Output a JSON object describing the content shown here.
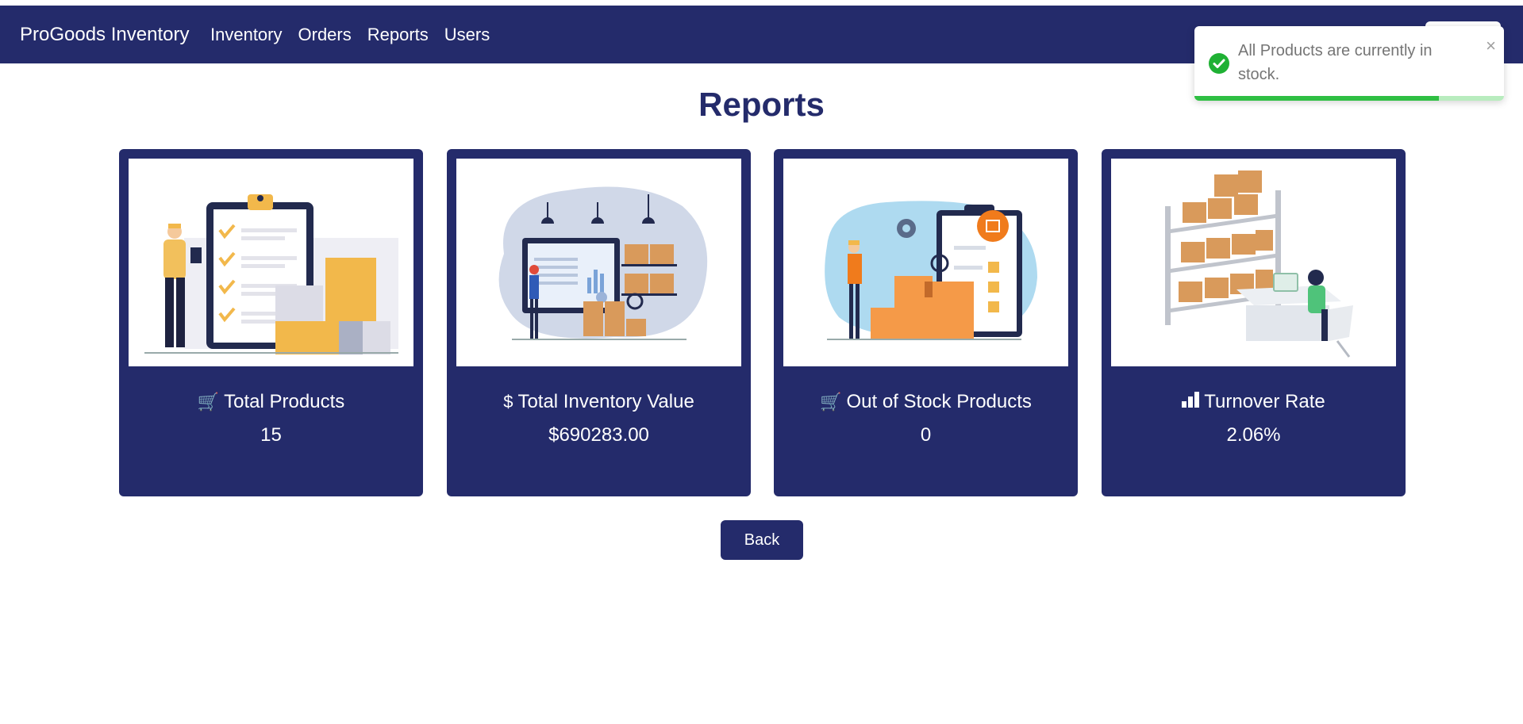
{
  "app": {
    "brand": "ProGoods Inventory"
  },
  "nav": {
    "links": [
      "Inventory",
      "Orders",
      "Reports",
      "Users"
    ]
  },
  "toast": {
    "message": "All Products are currently in stock.",
    "close": "×",
    "progress": 0.79
  },
  "page": {
    "title": "Reports"
  },
  "cards": [
    {
      "icon": "cart-icon",
      "glyph": "🛒",
      "label": "Total Products",
      "value": "15"
    },
    {
      "icon": "dollar-icon",
      "glyph": "$",
      "label": "Total Inventory Value",
      "value": "$690283.00"
    },
    {
      "icon": "cart-x-icon",
      "glyph": "🛒",
      "label": "Out of Stock Products",
      "value": "0"
    },
    {
      "icon": "bar-chart-icon",
      "glyph": "▮",
      "label": "Turnover Rate",
      "value": "2.06%"
    }
  ],
  "actions": {
    "back": "Back"
  },
  "colors": {
    "primary": "#242b6b",
    "success": "#1fb134",
    "accent": "#f2b84b",
    "orange": "#f59a48"
  }
}
